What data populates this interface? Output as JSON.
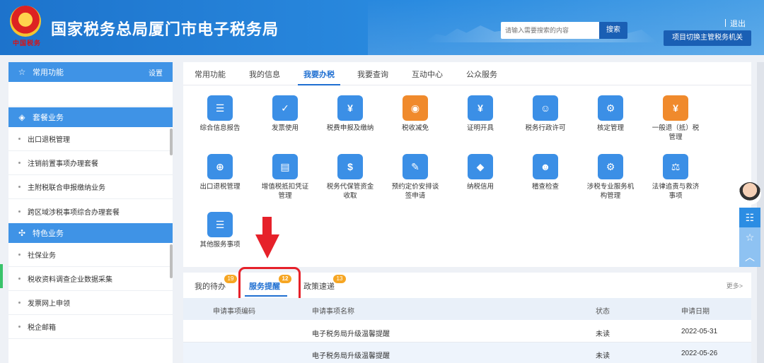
{
  "header": {
    "emblem_text": "中国税务",
    "title": "国家税务总局厦门市电子税务局",
    "search_placeholder": "请输入需要搜索的内容",
    "search_button": "搜索",
    "logout": "退出",
    "switch_button": "项目切换主管税务机关"
  },
  "sidebar": {
    "common": {
      "label": "常用功能",
      "settings": "设置",
      "icon": "star-icon"
    },
    "package": {
      "label": "套餐业务",
      "icon": "cube-icon",
      "items": [
        "出口退税管理",
        "注销前置事项办理套餐",
        "主附税联合申报缴纳业务",
        "跨区域涉税事项综合办理套餐"
      ]
    },
    "featured": {
      "label": "特色业务",
      "icon": "grid-icon",
      "items": [
        "社保业务",
        "税收资料调查企业数据采集",
        "发票网上申领",
        "税企邮箱"
      ]
    }
  },
  "main_tabs": [
    "常用功能",
    "我的信息",
    "我要办税",
    "我要查询",
    "互动中心",
    "公众服务"
  ],
  "active_tab": "我要办税",
  "functions": [
    {
      "label": "综合信息报告",
      "icon": "clipboard-icon",
      "color": "#3b8fe6",
      "glyph": "☰"
    },
    {
      "label": "发票使用",
      "icon": "ticket-icon",
      "color": "#3b8fe6",
      "glyph": "✓"
    },
    {
      "label": "税费申报及缴纳",
      "icon": "wallet-icon",
      "color": "#3b8fe6",
      "glyph": "¥"
    },
    {
      "label": "税收减免",
      "icon": "coin-icon",
      "color": "#f08a2c",
      "glyph": "◉"
    },
    {
      "label": "证明开具",
      "icon": "certificate-icon",
      "color": "#3b8fe6",
      "glyph": "¥"
    },
    {
      "label": "税务行政许可",
      "icon": "id-card-icon",
      "color": "#3b8fe6",
      "glyph": "☺"
    },
    {
      "label": "核定管理",
      "icon": "user-gear-icon",
      "color": "#3b8fe6",
      "glyph": "⚙"
    },
    {
      "label": "一般退（抵）税\n管理",
      "icon": "refund-icon",
      "color": "#f08a2c",
      "glyph": "¥"
    },
    {
      "label": "出口退税管理",
      "icon": "globe-icon",
      "color": "#3b8fe6",
      "glyph": "⊕"
    },
    {
      "label": "增值税抵扣凭证\n管理",
      "icon": "voucher-icon",
      "color": "#3b8fe6",
      "glyph": "▤"
    },
    {
      "label": "税务代保管资金\n收取",
      "icon": "money-bag-icon",
      "color": "#3b8fe6",
      "glyph": "$"
    },
    {
      "label": "预约定价安排谈\n签申请",
      "icon": "compass-icon",
      "color": "#3b8fe6",
      "glyph": "✎"
    },
    {
      "label": "纳税信用",
      "icon": "diamond-icon",
      "color": "#3b8fe6",
      "glyph": "◆"
    },
    {
      "label": "稽查检查",
      "icon": "inspector-icon",
      "color": "#3b8fe6",
      "glyph": "☻"
    },
    {
      "label": "涉税专业服务机\n构管理",
      "icon": "agent-gear-icon",
      "color": "#3b8fe6",
      "glyph": "⚙"
    },
    {
      "label": "法律追责与救济\n事项",
      "icon": "gavel-icon",
      "color": "#3b8fe6",
      "glyph": "⚖"
    },
    {
      "label": "其他服务事项",
      "icon": "list-icon",
      "color": "#3b8fe6",
      "glyph": "☰"
    }
  ],
  "notice": {
    "tabs": [
      {
        "label": "我的待办",
        "count": "19"
      },
      {
        "label": "服务提醒",
        "count": "12"
      },
      {
        "label": "政策速递",
        "count": "13"
      }
    ],
    "active": "服务提醒",
    "more": "更多>",
    "columns": [
      "申请事项编码",
      "申请事项名称",
      "状态",
      "申请日期"
    ],
    "rows": [
      {
        "code": "",
        "name": "电子税务局升级温馨提醒",
        "status": "未读",
        "date": "2022-05-31"
      },
      {
        "code": "",
        "name": "电子税务局升级温馨提醒",
        "status": "未读",
        "date": "2022-05-26"
      }
    ]
  },
  "float_bar": [
    "chat-icon",
    "star-icon",
    "up-icon"
  ]
}
